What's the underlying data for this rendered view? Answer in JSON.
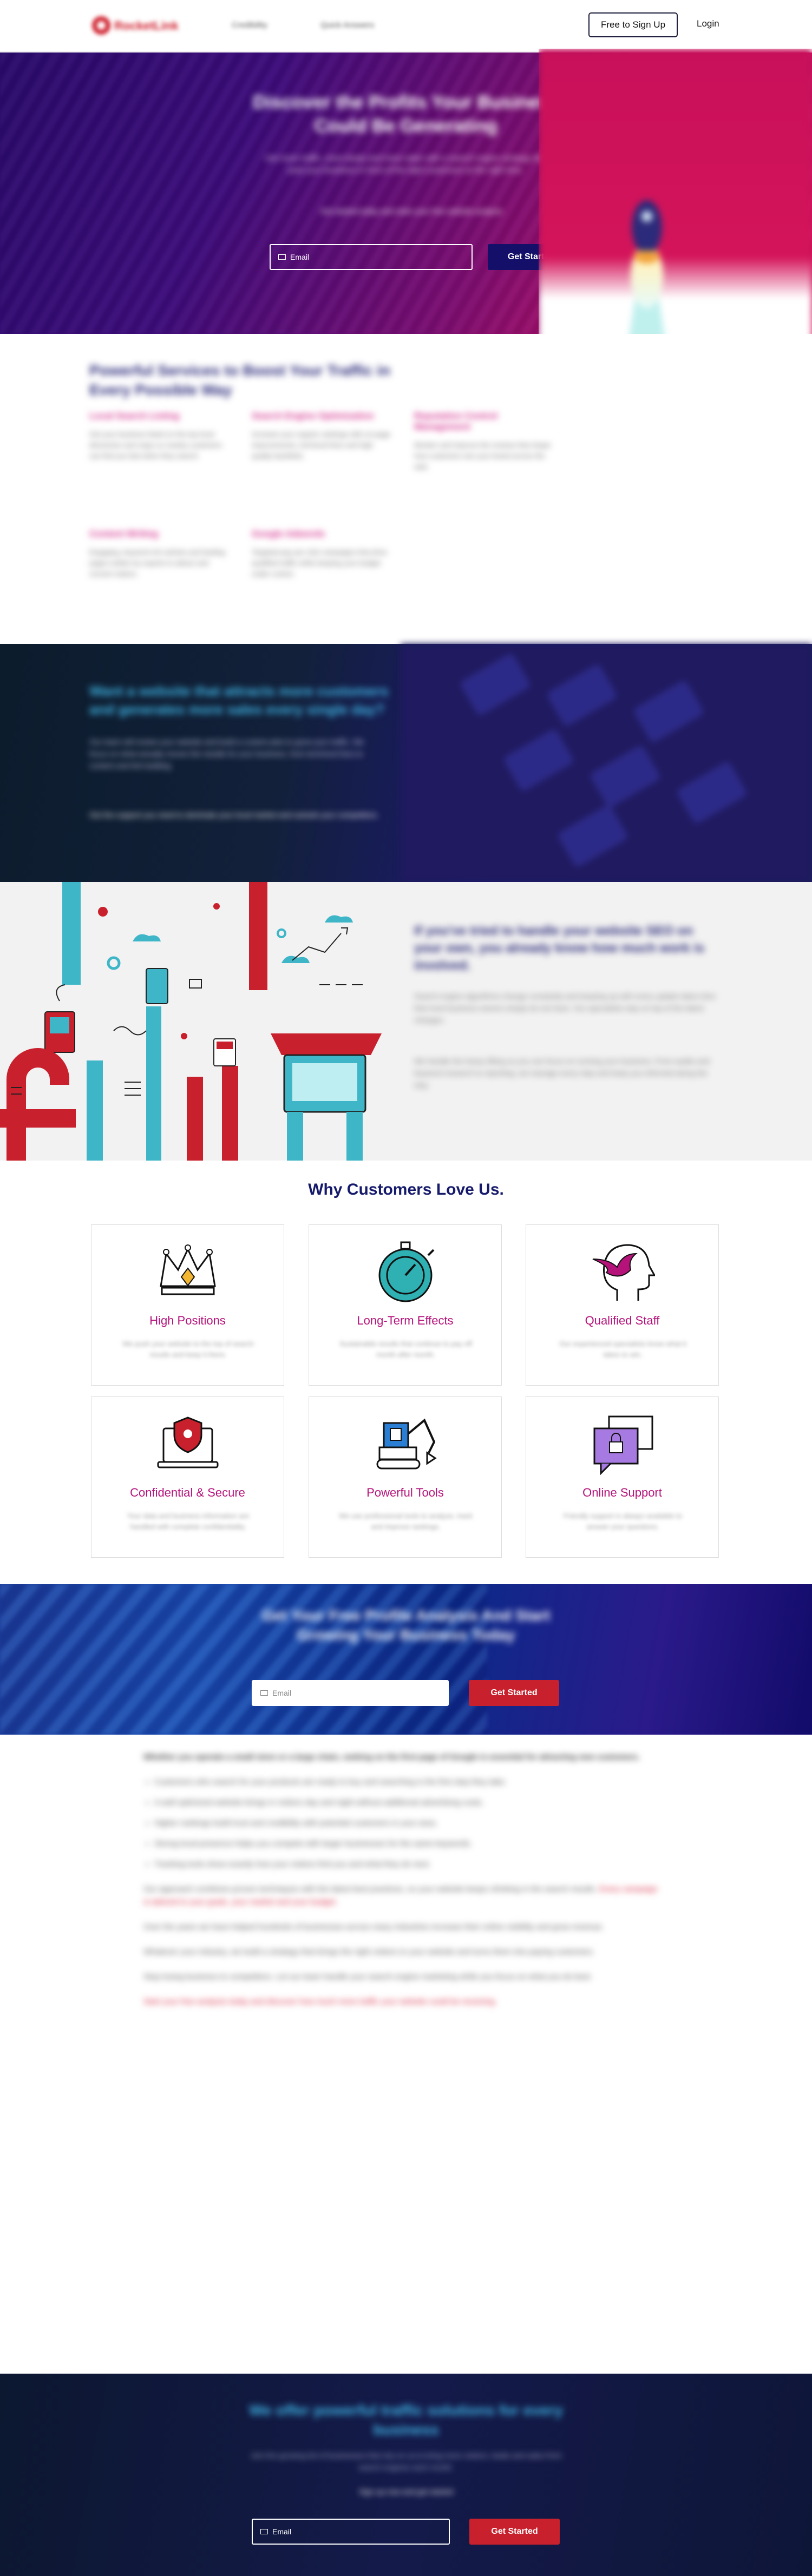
{
  "header": {
    "brand": "RocketLink",
    "nav": [
      "Credibility",
      "Quick Answers"
    ],
    "signup_label": "Free to Sign Up",
    "login_label": "Login"
  },
  "hero": {
    "title": "Discover the Profits Your Business Could Be Generating",
    "subtitle": "Get more traffic, more leads and more sales with a search engine strategy that puts your business in front of the right customers at the right time.",
    "note": "Get started today and claim your free website analysis",
    "email_placeholder": "Email",
    "cta_label": "Get Started"
  },
  "services": {
    "title": "Powerful Services to Boost Your Traffic in Every Possible Way",
    "items": [
      {
        "title": "Local Search Listing",
        "text": "Get your business listed on the top local directories and maps so nearby customers can find you fast when they search."
      },
      {
        "title": "Search Engine Optimization",
        "text": "Increase your organic rankings with on-page improvements, technical fixes and high quality backlinks."
      },
      {
        "title": "Reputation Control Management",
        "text": "Monitor and improve the reviews that shape how customers see your brand across the web."
      },
      {
        "title": "Content Writing",
        "text": "Engaging, keyword rich articles and landing pages written by experts to attract and convert visitors."
      },
      {
        "title": "Google Adwords",
        "text": "Targeted pay per click campaigns that drive qualified traffic while keeping your budget under control."
      }
    ]
  },
  "dark_band": {
    "title": "Want a website that attracts more customers and generates more sales every single day?",
    "p1": "Our team will review your website and build a custom plan to grow your traffic. We focus on what actually moves the needle for your business, from technical fixes to content and link building.",
    "p2": "Get the support you need to dominate your local market and outrank your competitors."
  },
  "illustration_section": {
    "title": "If you've tried to handle your website SEO on your own, you already know how much work is involved.",
    "p1": "Search engine algorithms change constantly and keeping up with every update takes time that most business owners simply do not have. Our specialists stay on top of the latest changes.",
    "p2": "We handle the heavy lifting so you can focus on running your business. From audits and keyword research to reporting, we manage every step and keep you informed along the way."
  },
  "why": {
    "title": "Why Customers Love Us.",
    "cards": [
      {
        "title": "High Positions",
        "text": "We push your website to the top of search results and keep it there."
      },
      {
        "title": "Long-Term Effects",
        "text": "Sustainable results that continue to pay off month after month."
      },
      {
        "title": "Qualified Staff",
        "text": "Our experienced specialists know what it takes to win."
      },
      {
        "title": "Confidential & Secure",
        "text": "Your data and business information are handled with complete confidentiality."
      },
      {
        "title": "Powerful Tools",
        "text": "We use professional tools to analyze, track and improve rankings."
      },
      {
        "title": "Online Support",
        "text": "Friendly support is always available to answer your questions."
      }
    ]
  },
  "cta1": {
    "title": "Get Your Free Profile Analysis And Start Growing Your Business Today",
    "email_placeholder": "Email",
    "cta_label": "Get Started"
  },
  "article": {
    "intro": "Whether you operate a small store or a large chain, ranking on the first page of Google is essential for attracting new customers.",
    "bullets": [
      "Customers who search for your products are ready to buy and searching is the first step they take.",
      "A well optimized website brings in visitors day and night without additional advertising costs.",
      "Higher rankings build trust and credibility with potential customers in your area.",
      "Strong local presence helps you compete with larger businesses for the same keywords.",
      "Tracking tools show exactly how your visitors find you and what they do next."
    ],
    "p1": "Our approach combines proven techniques with the latest best practices, so your website keeps climbing in the search results.",
    "p1_red": "Every campaign is tailored to your goals, your market and your budget.",
    "p2": "Over the years we have helped hundreds of businesses across many industries increase their online visibility and grow revenue.",
    "p3": "Whatever your industry, we build a strategy that brings the right visitors to your website and turns them into paying customers.",
    "p4": "Stop losing business to competitors. Let our team handle your search engine marketing while you focus on what you do best.",
    "p5_red": "Start your free analysis today and discover how much more traffic your website could be receiving."
  },
  "bottom": {
    "title": "We offer powerful traffic solutions for every business",
    "p": "Join the growing list of businesses that rely on us to bring more visitors, leads and sales from search engines each month.",
    "note": "Sign up now and get started",
    "email_placeholder": "Email",
    "cta_label": "Get Started"
  },
  "colors": {
    "accent_red": "#d0222f",
    "brand_navy": "#151a6b",
    "card_title": "#b5127a",
    "teal": "#3fb6e6"
  }
}
